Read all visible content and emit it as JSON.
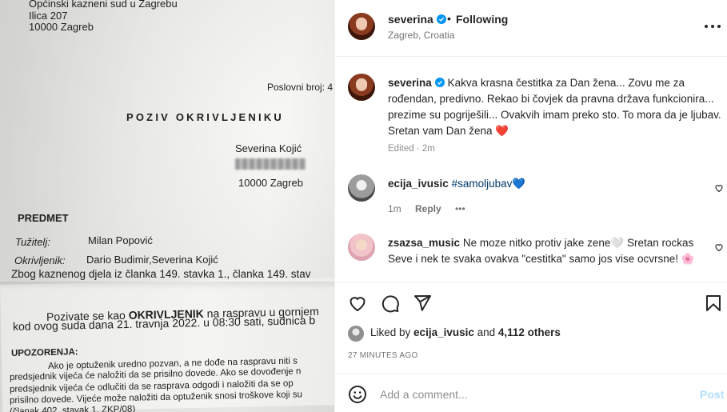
{
  "photo": {
    "court_line1": "Općinski kazneni sud u Zagrebu",
    "court_line2": "Ilica 207",
    "court_line3": "10000 Zagreb",
    "case_no": "Poslovni broj: 4",
    "title": "POZIV OKRIVLJENIKU",
    "addressee_name": "Severina Kojić",
    "addressee_city": "10000 Zagreb",
    "subject_heading": "PREDMET",
    "plaintiff_label": "Tužitelj:",
    "plaintiff_value": "Milan Popović",
    "accused_label": "Okrivljenik:",
    "accused_value": "Dario Budimir,Severina Kojić",
    "offence_line": "Zbog kaznenog djela iz članka 149. stavka 1., članka 149. stav",
    "summon_prefix": "Pozivate se kao ",
    "summon_bold": "OKRIVLJENIK",
    "summon_suffix": " na raspravu u gornjem",
    "summon_line2": "kod ovog suda dana 21. travnja 2022.  u 08:30  sati, sudnica b",
    "warning_heading": "UPOZORENJA:",
    "warning_lines": [
      "Ako je optuženik uredno pozvan, a ne dođe na raspravu niti s",
      "predsjednik vijeća će naložiti da se prisilno dovede. Ako se dovođenje n",
      "predsjednik vijeća će odlučiti da se rasprava odgodi i naložiti da se op",
      "prisilno dovede. Vijeće može naložiti da optuženik snosi troškove koji su",
      "(članak 402. stavak 1. ZKP/08)"
    ]
  },
  "header": {
    "username": "severina",
    "dot": "•",
    "follow_status": "Following",
    "location": "Zagreb, Croatia"
  },
  "caption": {
    "username": "severina",
    "text": "Kakva krasna čestitka za Dan žena... Zovu me za rođendan, predivno. Rekao bi čovjek da pravna država funkcionira... prezime su pogriješili... Ovakvih imam preko sto. To mora da je ljubav. Sretan vam Dan žena",
    "emoji": "❤️",
    "edited": "Edited · 2m"
  },
  "comments": [
    {
      "username": "ecija_ivusic",
      "text": "#samoljubav",
      "emoji": "💙",
      "time": "1m",
      "reply": "Reply",
      "more": "•••"
    },
    {
      "username": "zsazsa_music",
      "text": "Ne moze nitko protiv jake zene🤍 Sretan rockas Seve i nek te svaka ovakva \"cestitka\" samo jos vise ocvrsne!",
      "emoji": "🌸"
    }
  ],
  "likes": {
    "prefix": "Liked by ",
    "first_liker": "ecija_ivusic",
    "middle": " and ",
    "others": "4,112 others"
  },
  "time_ago": "27 MINUTES AGO",
  "add_comment": {
    "placeholder": "Add a comment...",
    "post_label": "Post"
  },
  "colors": {
    "verified": "#0095f6",
    "link": "#00376b",
    "heart": "#ed4956",
    "post_disabled": "#b2dffc"
  },
  "icons": [
    "verified-badge-icon",
    "more-options-icon",
    "heart-icon",
    "comment-icon",
    "share-icon",
    "bookmark-icon",
    "emoji-icon"
  ]
}
